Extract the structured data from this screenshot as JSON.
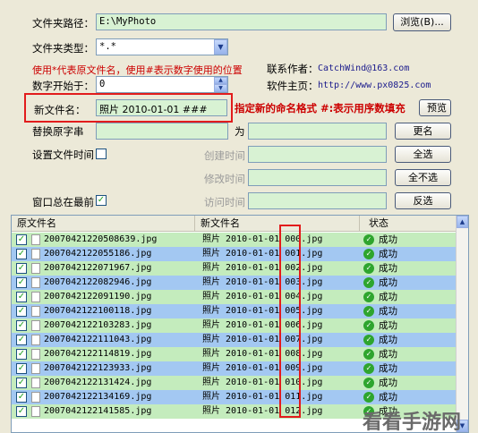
{
  "folder_path": {
    "label": "文件夹路径：",
    "value": "E:\\MyPhoto",
    "browse_label": "浏览(B)..."
  },
  "folder_type": {
    "label": "文件夹类型：",
    "value": "*.*"
  },
  "hint_wildcard": "使用*代表原文件名，使用#表示数字使用的位置",
  "contact": {
    "author_label": "联系作者：",
    "author_value": "CatchWind@163.com",
    "home_label": "软件主页：",
    "home_value": "http://www.px0825.com"
  },
  "number_start": {
    "label": "数字开始于：",
    "value": "0"
  },
  "new_name": {
    "label": "新文件名：",
    "value": "照片 2010-01-01 ###",
    "preview_label": "预览",
    "annotation": "指定新的命名格式 #:表示用序数填充"
  },
  "replace": {
    "label": "替换原字串",
    "to_label": "为",
    "rename_label": "更名"
  },
  "set_time": {
    "label": "设置文件时间",
    "created_label": "创建时间",
    "modified_label": "修改时间",
    "accessed_label": "访问时间",
    "select_all_label": "全选",
    "select_none_label": "全不选",
    "invert_label": "反选"
  },
  "always_on_top": {
    "label": "窗口总在最前",
    "checked": true
  },
  "list": {
    "headers": [
      "原文件名",
      "新文件名",
      "状态"
    ],
    "rows": [
      {
        "orig": "20070421220508639.jpg",
        "new": "照片 2010-01-01 000.jpg",
        "status": "成功"
      },
      {
        "orig": "2007042122055186.jpg",
        "new": "照片 2010-01-01 001.jpg",
        "status": "成功"
      },
      {
        "orig": "2007042122071967.jpg",
        "new": "照片 2010-01-01 002.jpg",
        "status": "成功"
      },
      {
        "orig": "2007042122082946.jpg",
        "new": "照片 2010-01-01 003.jpg",
        "status": "成功"
      },
      {
        "orig": "2007042122091190.jpg",
        "new": "照片 2010-01-01 004.jpg",
        "status": "成功"
      },
      {
        "orig": "2007042122100118.jpg",
        "new": "照片 2010-01-01 005.jpg",
        "status": "成功"
      },
      {
        "orig": "2007042122103283.jpg",
        "new": "照片 2010-01-01 006.jpg",
        "status": "成功"
      },
      {
        "orig": "2007042122111043.jpg",
        "new": "照片 2010-01-01 007.jpg",
        "status": "成功"
      },
      {
        "orig": "2007042122114819.jpg",
        "new": "照片 2010-01-01 008.jpg",
        "status": "成功"
      },
      {
        "orig": "2007042122123933.jpg",
        "new": "照片 2010-01-01 009.jpg",
        "status": "成功"
      },
      {
        "orig": "2007042122131424.jpg",
        "new": "照片 2010-01-01 010.jpg",
        "status": "成功"
      },
      {
        "orig": "2007042122134169.jpg",
        "new": "照片 2010-01-01 011.jpg",
        "status": "成功"
      },
      {
        "orig": "2007042122141585.jpg",
        "new": "照片 2010-01-01 012.jpg",
        "status": "成功"
      }
    ]
  },
  "watermark": "看看手游网",
  "colors": {
    "field_bg": "#d8f2d3",
    "row_green": "#c4ecbd",
    "row_blue": "#a3c8f2",
    "highlight": "#e21c1c"
  }
}
